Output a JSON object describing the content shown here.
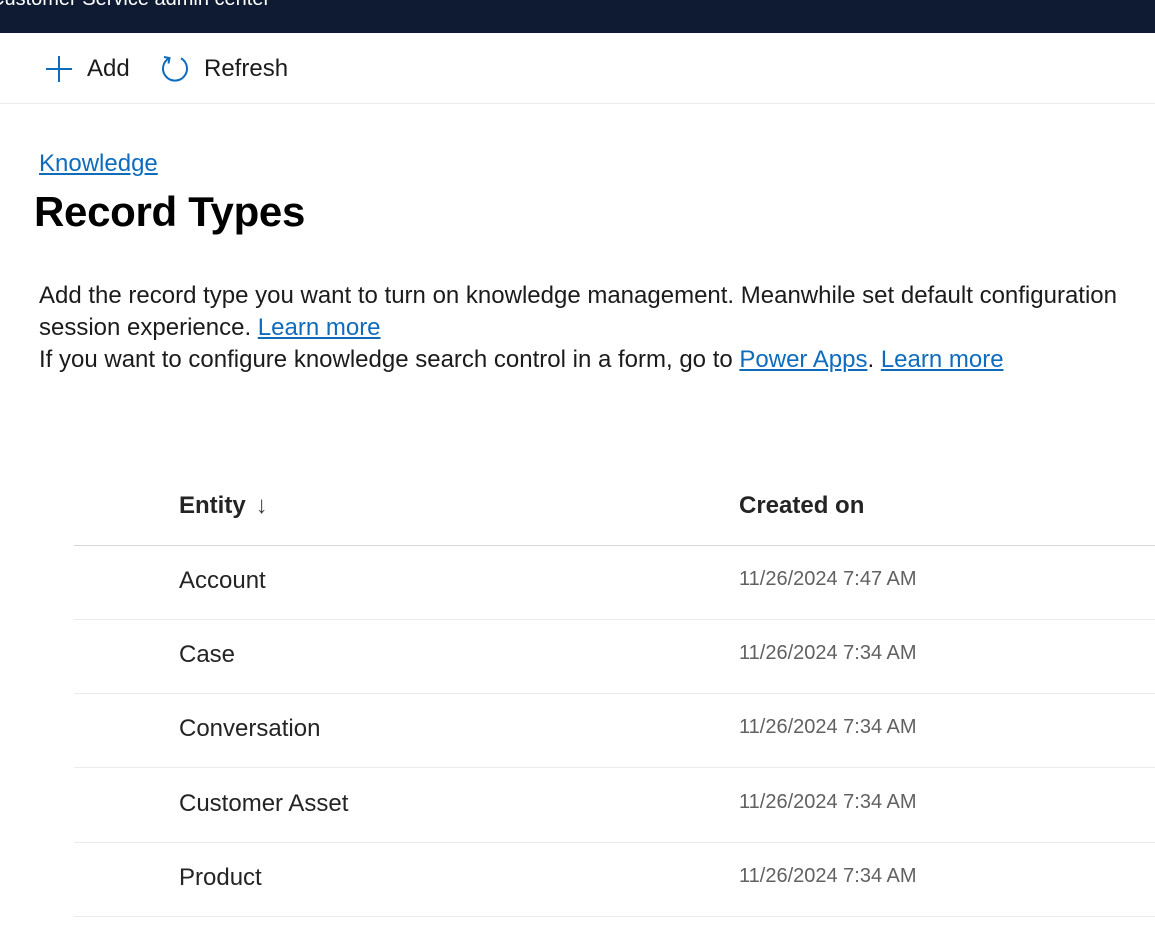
{
  "header": {
    "title": "Customer Service admin center"
  },
  "toolbar": {
    "add_label": "Add",
    "refresh_label": "Refresh"
  },
  "breadcrumb": {
    "label": "Knowledge"
  },
  "page": {
    "title": "Record Types",
    "desc_line1": "Add the record type you want to turn on knowledge management. Meanwhile set default configuration",
    "desc_line2": "session experience.",
    "learn_more": "Learn more",
    "desc_line3": "If you want to configure knowledge search control in a form, go to",
    "power_apps": "Power Apps",
    "period": "."
  },
  "table": {
    "columns": {
      "entity": "Entity",
      "created": "Created on"
    },
    "sort_indicator": "↓",
    "rows": [
      {
        "entity": "Account",
        "created": "11/26/2024 7:47 AM"
      },
      {
        "entity": "Case",
        "created": "11/26/2024 7:34 AM"
      },
      {
        "entity": "Conversation",
        "created": "11/26/2024 7:34 AM"
      },
      {
        "entity": "Customer Asset",
        "created": "11/26/2024 7:34 AM"
      },
      {
        "entity": "Product",
        "created": "11/26/2024 7:34 AM"
      }
    ]
  },
  "colors": {
    "topbar": "#0f1b33",
    "link": "#0f6cbd",
    "icon": "#0f6cbd"
  },
  "icons": {
    "add": "add-icon",
    "refresh": "refresh-icon",
    "sort": "arrow-down-icon"
  }
}
